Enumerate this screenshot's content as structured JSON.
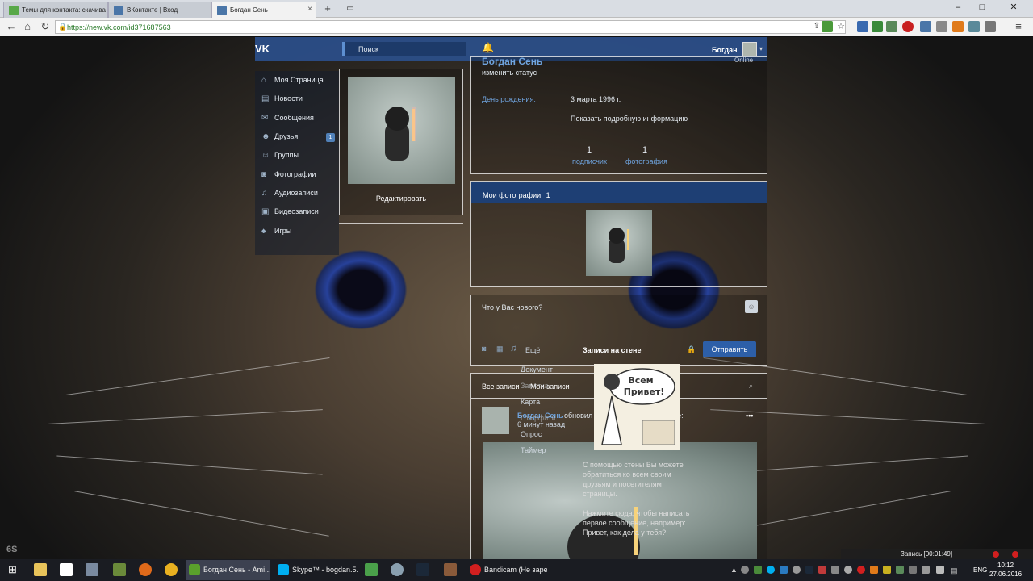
{
  "browser": {
    "tabs": [
      {
        "title": "Темы для контакта: скачива",
        "color": "#58a848"
      },
      {
        "title": "ВКонтакте | Вход",
        "color": "#4a76a8"
      },
      {
        "title": "Богдан Сень",
        "color": "#4a76a8"
      }
    ],
    "url": "https://new.vk.com/id371687563",
    "new_tab": "+",
    "window_controls": {
      "minimize": "–",
      "maximize": "□",
      "close": "✕"
    }
  },
  "vk": {
    "search_placeholder": "Поиск",
    "user_name": "Богдан",
    "menu": [
      {
        "label": "Моя Страница",
        "icon": "home-icon",
        "glyph": "⌂"
      },
      {
        "label": "Новости",
        "icon": "news-icon",
        "glyph": "▤"
      },
      {
        "label": "Сообщения",
        "icon": "messages-icon",
        "glyph": "✉"
      },
      {
        "label": "Друзья",
        "icon": "friends-icon",
        "glyph": "☻"
      },
      {
        "label": "Группы",
        "icon": "groups-icon",
        "glyph": "☺"
      },
      {
        "label": "Фотографии",
        "icon": "camera-icon",
        "glyph": "◙"
      },
      {
        "label": "Аудиозаписи",
        "icon": "music-icon",
        "glyph": "♫"
      },
      {
        "label": "Видеозаписи",
        "icon": "video-icon",
        "glyph": "▣"
      },
      {
        "label": "Игры",
        "icon": "games-icon",
        "glyph": "♠"
      }
    ],
    "friends_badge": "1",
    "edit_label": "Редактировать",
    "profile": {
      "name": "Богдан Сень",
      "online": "Online",
      "status": "изменить статус",
      "birthday_label": "День рождения:",
      "birthday_value": "3 марта 1996 г.",
      "show_more": "Показать подробную информацию",
      "followers_count": "1",
      "followers_label": "подписчик",
      "photos_count": "1",
      "photos_label": "фотография"
    },
    "my_photos": {
      "title": "Мои фотографии",
      "count": "1"
    },
    "composer": {
      "placeholder": "Что у Вас нового?",
      "more": "Ещё",
      "wall_posts": "Записи на стене",
      "send": "Отправить"
    },
    "more_menu": [
      "Документ",
      "Заметка",
      "Карта",
      "Граффити",
      "Опрос",
      "Таймер"
    ],
    "wall_tabs": {
      "all": "Все записи",
      "mine": "Мои записи"
    },
    "post": {
      "author": "Богдан Сень",
      "action": "обновил фотографию на странице:",
      "time": "6 минут назад",
      "options": "•••"
    },
    "empty_wall": {
      "line1": "С помощью стены Вы можете",
      "line2": "обратиться ко всем своим",
      "line3": "друзьям и посетителям",
      "line4": "страницы.",
      "line5": "Нажмите сюда, чтобы написать",
      "line6": "первое сообщение, например:",
      "line7": "Привет, как дела у тебя?"
    },
    "sticker_text": "Всем Привет!"
  },
  "overlay": {
    "watermark": "6S",
    "record_label": "Запись [00:01:49]"
  },
  "taskbar": {
    "apps": [
      {
        "label": "Богдан Сень - Ami...",
        "color": "#5aa02c",
        "active": true
      },
      {
        "label": "Skype™ - bogdan.5...",
        "color": "#00aff0",
        "active": false
      },
      {
        "label": "Bandicam (Не заре...",
        "color": "#d21f1f",
        "active": false
      }
    ],
    "lang": "ENG",
    "time": "10:12",
    "date": "27.06.2016"
  }
}
